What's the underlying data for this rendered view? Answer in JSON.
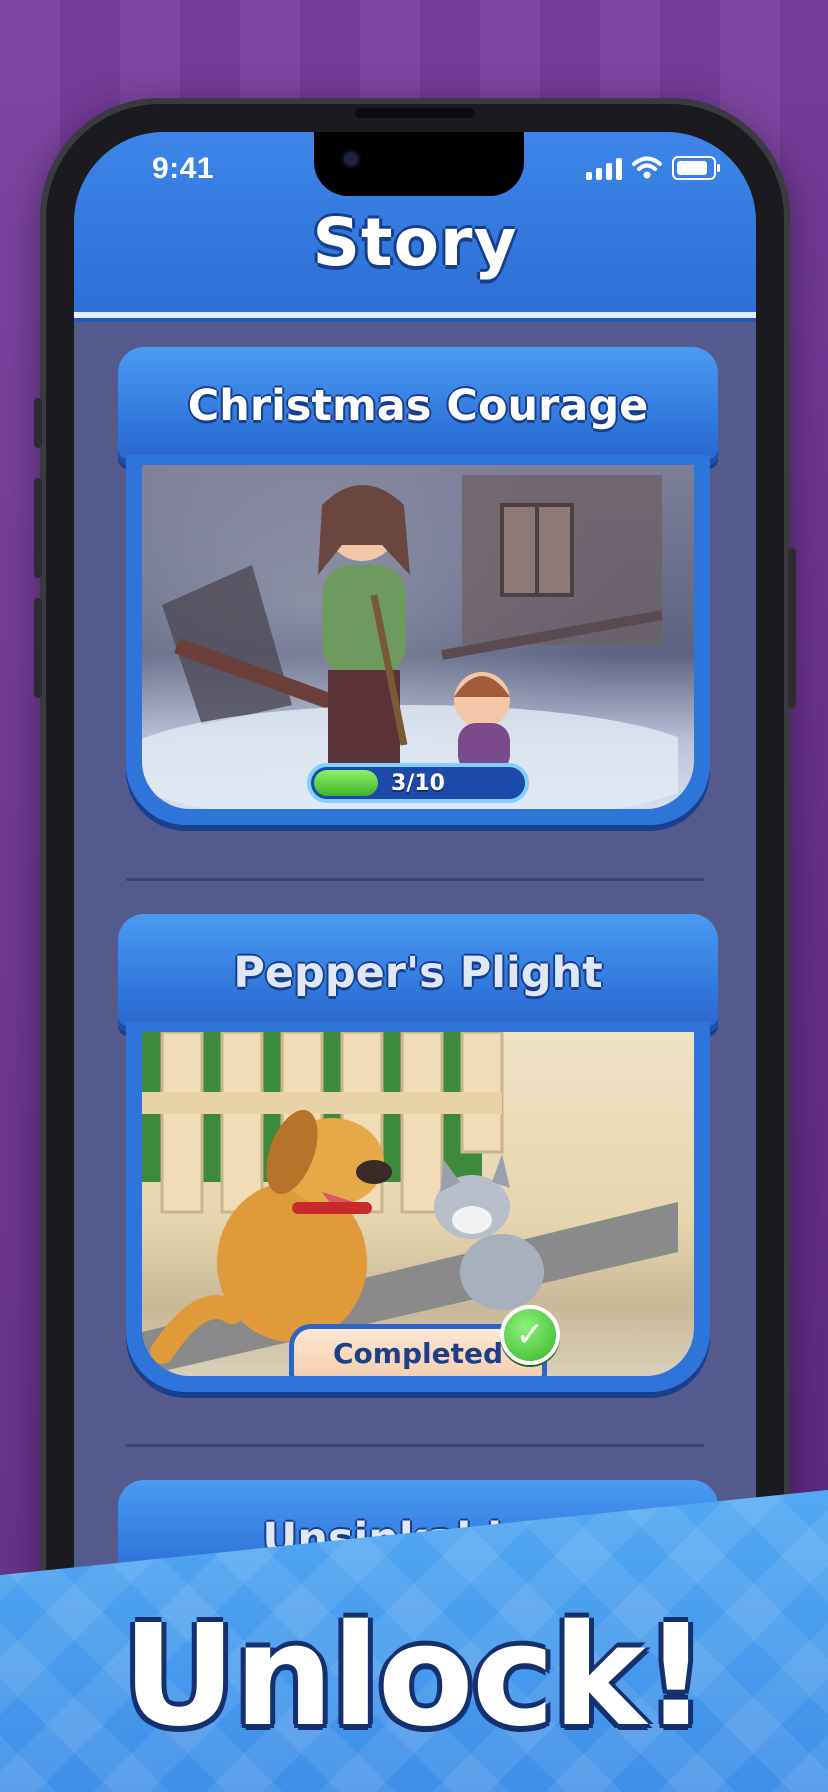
{
  "status_bar": {
    "time": "9:41"
  },
  "header": {
    "title": "Story"
  },
  "stories": [
    {
      "title": "Christmas Courage",
      "progress_text": "3/10",
      "progress": 0.3
    },
    {
      "title": "Pepper's Plight",
      "status": "Completed"
    },
    {
      "title": "Unsinkable L"
    }
  ],
  "promo": {
    "headline": "Unlock!"
  },
  "colors": {
    "accent": "#2f74d9",
    "background": "#6a3190",
    "screen": "#545a8c"
  }
}
